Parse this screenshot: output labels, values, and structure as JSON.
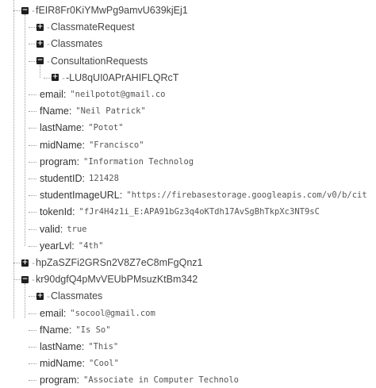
{
  "rows": [
    {
      "kind": "parent",
      "depth": 0,
      "key": "fEIR8Fr0KiYMwPg9amvU639kjEj1",
      "expanded": true
    },
    {
      "kind": "parent",
      "depth": 1,
      "key": "ClassmateRequest",
      "expanded": false
    },
    {
      "kind": "parent",
      "depth": 1,
      "key": "Classmates",
      "expanded": false
    },
    {
      "kind": "parent",
      "depth": 1,
      "key": "ConsultationRequests",
      "expanded": true
    },
    {
      "kind": "parent",
      "depth": 2,
      "key": "-LU8qUI0APrAHIFLQRcT",
      "expanded": false
    },
    {
      "kind": "leaf",
      "depth": 1,
      "key": "email",
      "value": "\"neilpotot@gmail.co"
    },
    {
      "kind": "leaf",
      "depth": 1,
      "key": "fName",
      "value": "\"Neil Patrick\""
    },
    {
      "kind": "leaf",
      "depth": 1,
      "key": "lastName",
      "value": "\"Potot\""
    },
    {
      "kind": "leaf",
      "depth": 1,
      "key": "midName",
      "value": "\"Francisco\""
    },
    {
      "kind": "leaf",
      "depth": 1,
      "key": "program",
      "value": "\"Information Technolog"
    },
    {
      "kind": "leaf",
      "depth": 1,
      "key": "studentID",
      "value": "121428"
    },
    {
      "kind": "leaf",
      "depth": 1,
      "key": "studentImageURL",
      "value": "\"https://firebasestorage.googleapis.com/v0/b/cit"
    },
    {
      "kind": "leaf",
      "depth": 1,
      "key": "tokenId",
      "value": "\"fJr4H4z1i_E:APA91bGz3q4oKTdh17AvSgBhTkpXc3NT9sC"
    },
    {
      "kind": "leaf",
      "depth": 1,
      "key": "valid",
      "value": "true"
    },
    {
      "kind": "leaf",
      "depth": 1,
      "key": "yearLvl",
      "value": "\"4th\""
    },
    {
      "kind": "parent",
      "depth": 0,
      "key": "hpZaSZFi2GRSn2V8Z7eC8mFgQnz1",
      "expanded": false
    },
    {
      "kind": "parent",
      "depth": 0,
      "key": "kr90dgfQ4pMvVEUbPMsuzKtBm342",
      "expanded": true
    },
    {
      "kind": "parent",
      "depth": 1,
      "key": "Classmates",
      "expanded": false
    },
    {
      "kind": "leaf",
      "depth": 1,
      "key": "email",
      "value": "\"socool@gmail.com"
    },
    {
      "kind": "leaf",
      "depth": 1,
      "key": "fName",
      "value": "\"Is So\""
    },
    {
      "kind": "leaf",
      "depth": 1,
      "key": "lastName",
      "value": "\"This\""
    },
    {
      "kind": "leaf",
      "depth": 1,
      "key": "midName",
      "value": "\"Cool\""
    },
    {
      "kind": "leaf",
      "depth": 1,
      "key": "program",
      "value": "\"Associate in Computer Technolo"
    }
  ]
}
